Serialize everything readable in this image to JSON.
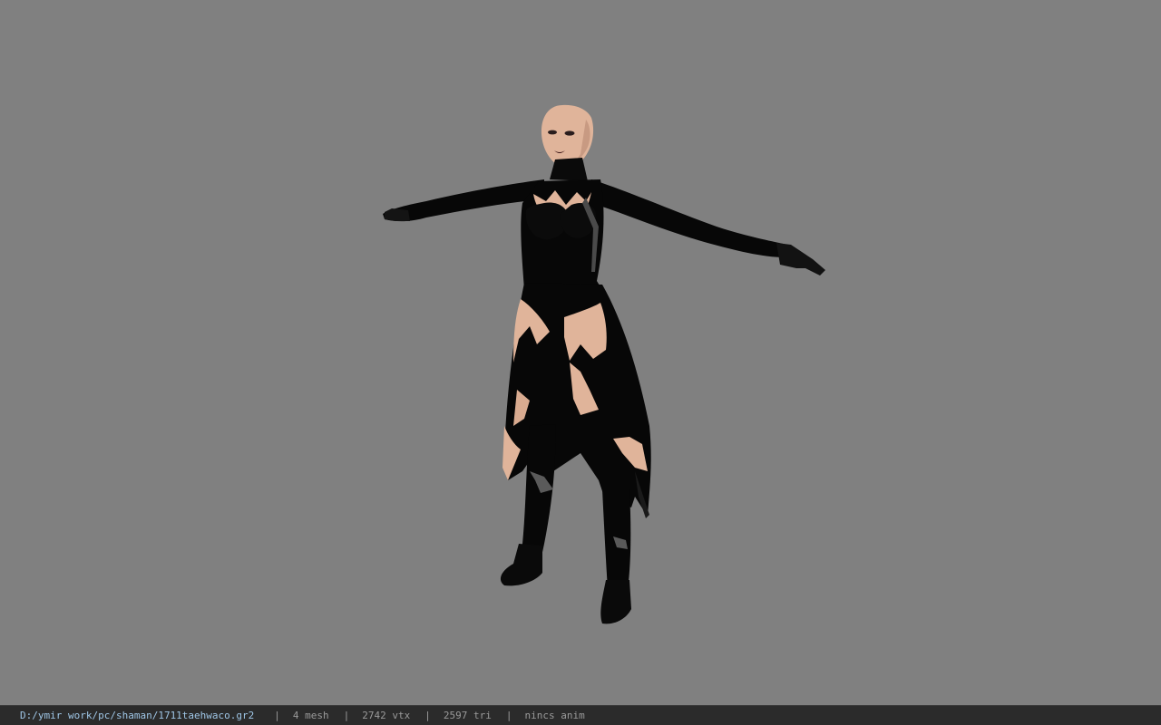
{
  "viewer": {
    "background_color": "#808080",
    "model_icon": "3d-character-model",
    "model_colors": {
      "skin": "#e0b49a",
      "outfit": "#070707",
      "highlight": "#4a4a4a"
    }
  },
  "status_bar": {
    "file_path": "D:/ymir work/pc/shaman/1711taehwaco.gr2",
    "separator": "|",
    "mesh_count": "4 mesh",
    "vertex_count": "2742 vtx",
    "triangle_count": "2597 tri",
    "anim_status": "nincs anim"
  }
}
